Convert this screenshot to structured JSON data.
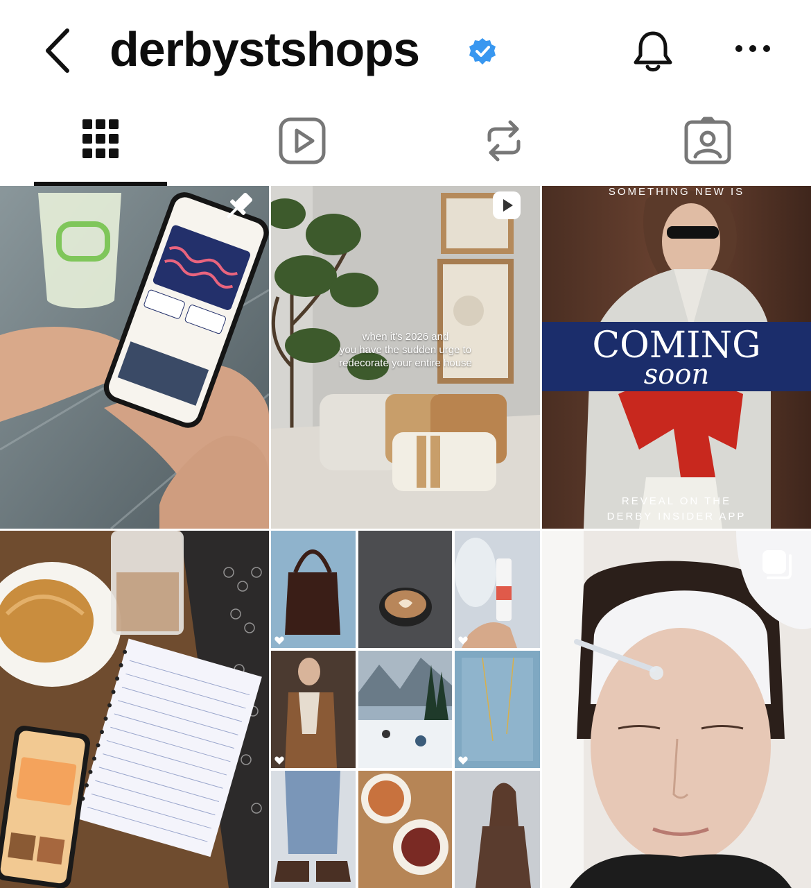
{
  "header": {
    "username": "derbystshops",
    "verified_icon": "verified-badge-icon",
    "back_icon": "chevron-left-icon",
    "notifications_icon": "bell-icon",
    "more_icon": "more-horizontal-icon"
  },
  "tabs": [
    {
      "name": "grid",
      "icon": "grid-icon",
      "selected": true
    },
    {
      "name": "reels",
      "icon": "reels-icon",
      "selected": false
    },
    {
      "name": "reposts",
      "icon": "repost-icon",
      "selected": false
    },
    {
      "name": "tagged",
      "icon": "tagged-icon",
      "selected": false
    }
  ],
  "posts": [
    {
      "kind": "pinned",
      "badge_icon": "pin-icon"
    },
    {
      "kind": "reel",
      "badge_icon": "reel-icon",
      "caption_lines": [
        "when it's 2026 and",
        "you have the sudden urge to",
        "redecorate your entire house"
      ]
    },
    {
      "kind": "image",
      "top_text": "SOMETHING NEW IS",
      "title": "COMING",
      "subtitle": "soon",
      "bottom_lines": [
        "REVEAL ON THE",
        "DERBY INSIDER APP"
      ]
    },
    {
      "kind": "image"
    },
    {
      "kind": "image"
    },
    {
      "kind": "carousel",
      "badge_icon": "carousel-icon"
    }
  ],
  "colors": {
    "coming_soon_band": "#1b2d6b",
    "verified_blue": "#3897f0",
    "icon_gray": "#777777"
  }
}
